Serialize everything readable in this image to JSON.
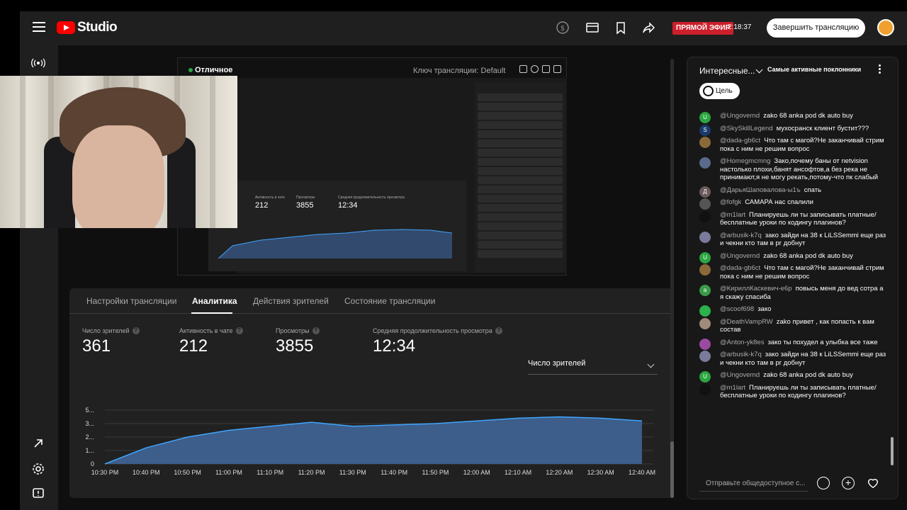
{
  "header": {
    "logo_text": "Studio",
    "live_badge": "ПРЯМОЙ ЭФИР",
    "live_time": "2:18:37",
    "end_button": "Завершить трансляцию"
  },
  "preview": {
    "status": "Отличное",
    "key_label": "Ключ трансляции: Default",
    "nested_metrics": [
      {
        "label": "Активность в чате",
        "value": "212"
      },
      {
        "label": "Просмотры",
        "value": "3855"
      },
      {
        "label": "Средняя продолжительность просмотра",
        "value": "12:34"
      }
    ]
  },
  "tabs": [
    "Настройки трансляции",
    "Аналитика",
    "Действия зрителей",
    "Состояние трансляции"
  ],
  "metrics": [
    {
      "label": "Число зрителей",
      "value": "361"
    },
    {
      "label": "Активность в чате",
      "value": "212"
    },
    {
      "label": "Просмотры",
      "value": "3855"
    },
    {
      "label": "Средняя продолжительность просмотра",
      "value": "12:34"
    }
  ],
  "dropdown_label": "Число зрителей",
  "chart_data": {
    "type": "area",
    "x": [
      "10:30 PM",
      "10:40 PM",
      "10:50 PM",
      "11:00 PM",
      "11:10 PM",
      "11:20 PM",
      "11:30 PM",
      "11:40 PM",
      "11:50 PM",
      "12:00 AM",
      "12:10 AM",
      "12:20 AM",
      "12:30 AM",
      "12:40 AM"
    ],
    "ytick_labels": [
      "0",
      "1...",
      "2...",
      "3...",
      "5..."
    ],
    "values": [
      0,
      1.2,
      2.0,
      2.5,
      2.8,
      3.1,
      2.8,
      2.9,
      3.0,
      3.2,
      3.4,
      3.5,
      3.4,
      3.2
    ],
    "ylim": [
      0,
      5
    ],
    "grid": true,
    "color": "#3d5d8a",
    "line_color": "#3ea6ff"
  },
  "chat": {
    "title": "Интересные...",
    "filter": "Самые активные поклонники",
    "goal_button": "Цель",
    "input_placeholder": "Отправьте общедоступное с...",
    "messages": [
      {
        "author": "@Ungovernd",
        "text": "zako 68 anka pod dk auto buy",
        "avatar": "U",
        "color": "#2ba640"
      },
      {
        "author": "@SkySkillLegend",
        "text": "мухосранск клиент бустит???",
        "avatar": "S",
        "color": "#1a3a6a"
      },
      {
        "author": "@dada-gb6ct",
        "text": "Что там с магой?Не заканчивай стрим пока с ним не решим вопрос",
        "avatar": "",
        "color": "#8a6a3a"
      },
      {
        "author": "@Homegmcmng",
        "text": "Зако,почему баны от netvision настолько плохи,банят ансофтов,а без река не принимают,я не могу рекать,потому-что пк слабый",
        "avatar": "",
        "color": "#5a6a8a"
      },
      {
        "author": "@ДарьяШаповалова-ы1ъ",
        "text": "спать",
        "avatar": "Д",
        "color": "#6b5b5b"
      },
      {
        "author": "@fofgk",
        "text": "САМАРА нас спалили",
        "avatar": "",
        "color": "#555"
      },
      {
        "author": "@m1lart",
        "text": "Планируешь ли ты записывать платные/бесплатные уроки по кодингу плагинов?",
        "avatar": "",
        "color": "#111"
      },
      {
        "author": "@arbusik-k7q",
        "text": "зако зайди на 38 к LiLSSemmi еще раз и чекни кто там в рг добнут",
        "avatar": "",
        "color": "#7a7a9a"
      },
      {
        "author": "@Ungovernd",
        "text": "zako 68 anka pod dk auto buy",
        "avatar": "U",
        "color": "#2ba640"
      },
      {
        "author": "@dada-gb6ct",
        "text": "Что там с магой?Не заканчивай стрим пока с ним не решим вопрос",
        "avatar": "",
        "color": "#8a6a3a"
      },
      {
        "author": "@КириллКаскевич-е6р",
        "text": "повысь меня до вед сотра а я скажу спасиба",
        "avatar": "а",
        "color": "#3a9a4a"
      },
      {
        "author": "@scoof698",
        "text": "зако",
        "avatar": "",
        "color": "#2bb24a"
      },
      {
        "author": "@DeathVampRW",
        "text": "zako привет , как попасть к вам состав",
        "avatar": "",
        "color": "#a08a7a"
      },
      {
        "author": "@Anton-yk8es",
        "text": "зако ты похудел а улыбка все таже",
        "avatar": "",
        "color": "#9a4aa0"
      },
      {
        "author": "@arbusik-k7q",
        "text": "зако зайди на 38 к LiLSSemmi еще раз и чекни кто там в рг добнут",
        "avatar": "",
        "color": "#7a7a9a"
      },
      {
        "author": "@Ungovernd",
        "text": "zako 68 anka pod dk auto buy",
        "avatar": "U",
        "color": "#2ba640"
      },
      {
        "author": "@m1lart",
        "text": "Планируешь ли ты записывать платные/бесплатные уроки по кодингу плагинов?",
        "avatar": "",
        "color": "#111"
      }
    ]
  }
}
